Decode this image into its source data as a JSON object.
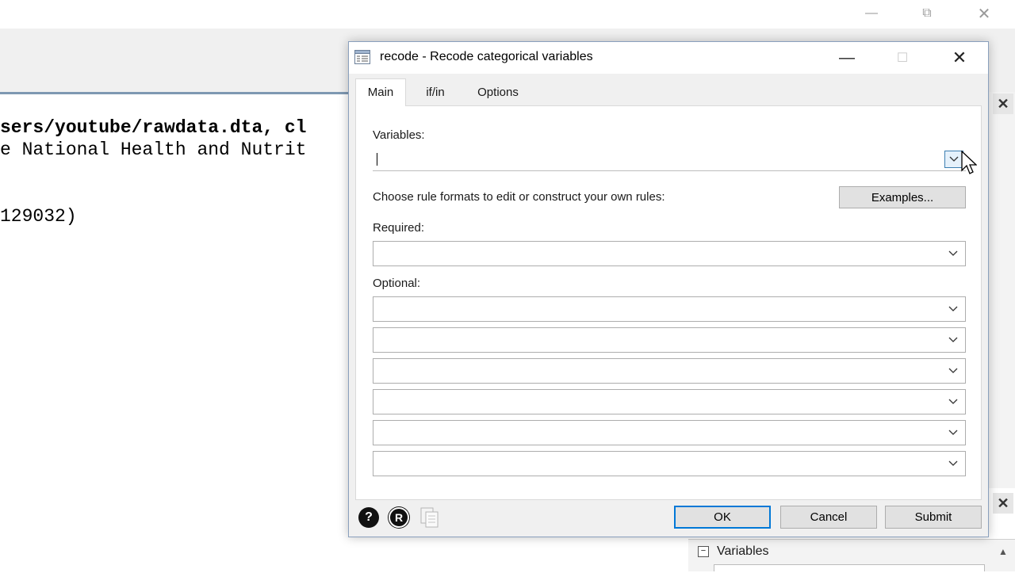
{
  "background": {
    "results_lines": [
      "sers/youtube/rawdata.dta, cl",
      "e National Health and Nutrit",
      "129032)"
    ],
    "variables_panel": {
      "title": "Variables"
    },
    "icons": [
      "minimize-icon",
      "restore-icon",
      "close-icon"
    ]
  },
  "dialog": {
    "title": "recode - Recode categorical variables",
    "tabs": [
      "Main",
      "if/in",
      "Options"
    ],
    "active_tab": "Main",
    "variables_label": "Variables:",
    "variables_value": "",
    "rules_instruction": "Choose rule formats to edit or construct your own rules:",
    "examples_button": "Examples...",
    "required_label": "Required:",
    "required_value": "",
    "optional_label": "Optional:",
    "optional_values": [
      "",
      "",
      "",
      "",
      "",
      ""
    ],
    "buttons": {
      "ok": "OK",
      "cancel": "Cancel",
      "submit": "Submit"
    },
    "footer_icons": {
      "help": "?",
      "reset": "R"
    }
  },
  "colors": {
    "default_button_border": "#0078d7",
    "results_separator": "#7e98b2",
    "dialog_background": "#f0f0f0"
  }
}
